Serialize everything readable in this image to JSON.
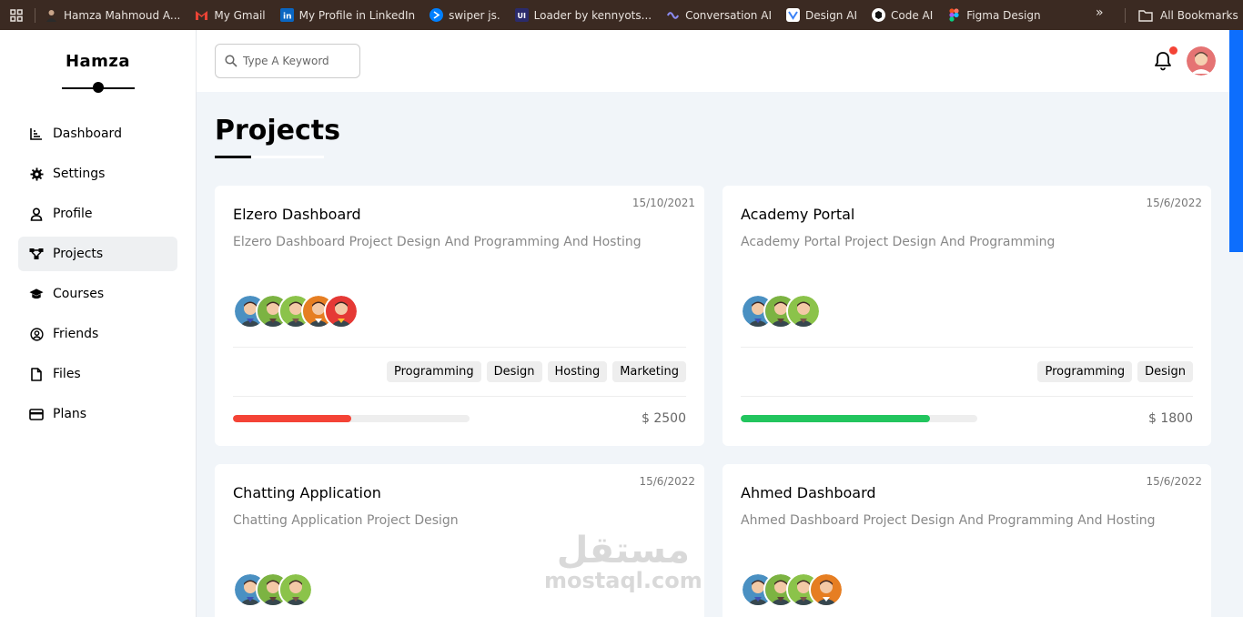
{
  "bookmarks": {
    "items": [
      {
        "label": "Hamza Mahmoud A...",
        "icon": "person-avatar-icon",
        "color": "#6b4e3d"
      },
      {
        "label": "My Gmail",
        "icon": "gmail-icon",
        "color": "#ea4335"
      },
      {
        "label": "My Profile in LinkedIn",
        "icon": "linkedin-icon",
        "color": "#0a66c2"
      },
      {
        "label": "swiper js.",
        "icon": "swiper-icon",
        "color": "#0080ff"
      },
      {
        "label": "Loader by kennyots...",
        "icon": "uiverse-icon",
        "color": "#2b2b6b"
      },
      {
        "label": "Conversation AI",
        "icon": "conversation-ai-icon",
        "color": "#5b5bd6"
      },
      {
        "label": "Design AI",
        "icon": "design-ai-icon",
        "color": "#3b82f6"
      },
      {
        "label": "Code AI",
        "icon": "code-ai-icon",
        "color": "#111111"
      },
      {
        "label": "Figma Design",
        "icon": "figma-icon",
        "color": "#f24e1e"
      }
    ],
    "more": "»",
    "all_bookmarks": "All Bookmarks"
  },
  "sidebar": {
    "brand": "Hamza",
    "items": [
      {
        "label": "Dashboard",
        "icon": "chart-icon"
      },
      {
        "label": "Settings",
        "icon": "gear-icon"
      },
      {
        "label": "Profile",
        "icon": "user-icon"
      },
      {
        "label": "Projects",
        "icon": "diagram-icon"
      },
      {
        "label": "Courses",
        "icon": "graduation-cap-icon"
      },
      {
        "label": "Friends",
        "icon": "user-circle-icon"
      },
      {
        "label": "Files",
        "icon": "file-icon"
      },
      {
        "label": "Plans",
        "icon": "credit-card-icon"
      }
    ],
    "active_index": 3
  },
  "header": {
    "search_placeholder": "Type A Keyword",
    "notification_color": "#f44336"
  },
  "page": {
    "title": "Projects"
  },
  "projects": [
    {
      "date": "15/10/2021",
      "title": "Elzero Dashboard",
      "description": "Elzero Dashboard Project Design And Programming And Hosting",
      "team_count": 5,
      "tags": [
        "Programming",
        "Design",
        "Hosting",
        "Marketing"
      ],
      "progress": 0.5,
      "progress_color": "#f44336",
      "price": "$ 2500"
    },
    {
      "date": "15/6/2022",
      "title": "Academy Portal",
      "description": "Academy Portal Project Design And Programming",
      "team_count": 3,
      "tags": [
        "Programming",
        "Design"
      ],
      "progress": 0.8,
      "progress_color": "#22c55e",
      "price": "$ 1800"
    },
    {
      "date": "15/6/2022",
      "title": "Chatting Application",
      "description": "Chatting Application Project Design",
      "team_count": 3,
      "tags": [],
      "progress": null,
      "progress_color": "",
      "price": ""
    },
    {
      "date": "15/6/2022",
      "title": "Ahmed Dashboard",
      "description": "Ahmed Dashboard Project Design And Programming And Hosting",
      "team_count": 4,
      "tags": [],
      "progress": null,
      "progress_color": "",
      "price": ""
    }
  ],
  "watermark": {
    "arabic": "مستقل",
    "latin": "mostaql.com"
  }
}
